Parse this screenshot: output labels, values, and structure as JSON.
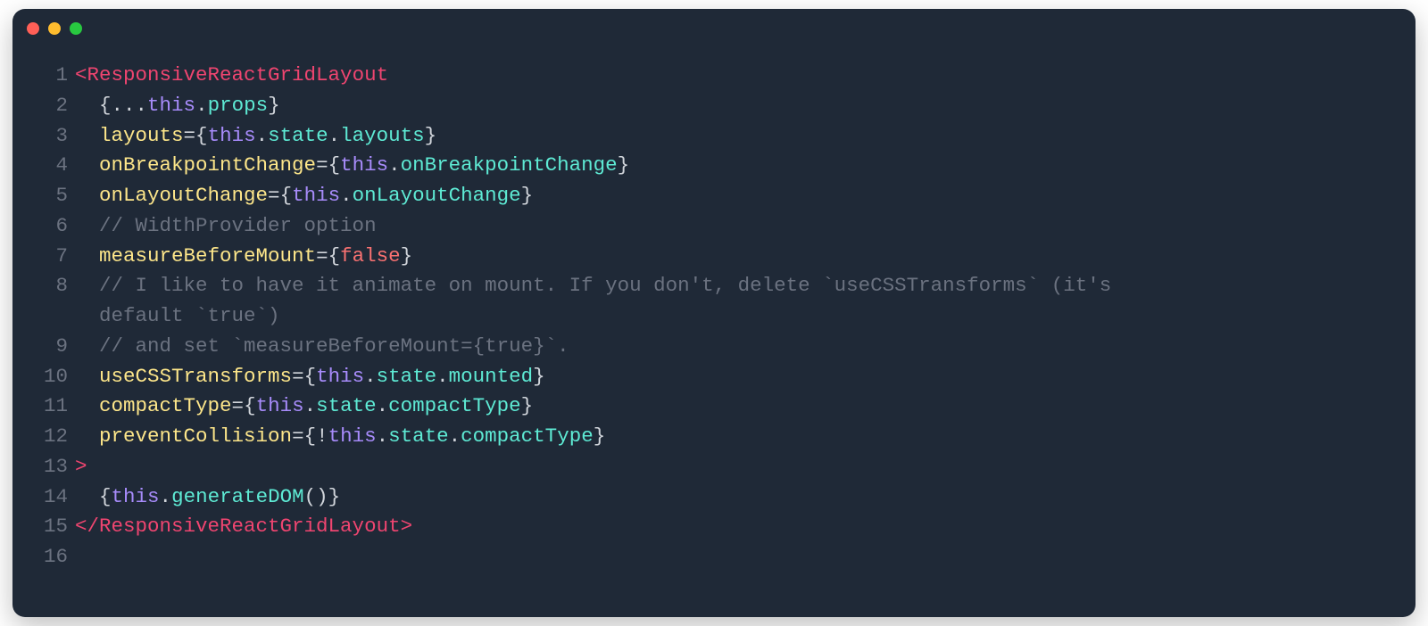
{
  "window": {
    "traffic_colors": {
      "close": "#ff5f57",
      "minimize": "#febc2e",
      "zoom": "#28c840"
    },
    "background": "#1f2937"
  },
  "code": {
    "line_numbers": [
      "1",
      "2",
      "3",
      "4",
      "5",
      "6",
      "7",
      "8",
      "9",
      "10",
      "11",
      "12",
      "13",
      "14",
      "15",
      "16"
    ],
    "lines": [
      {
        "n": "1",
        "segments": [
          {
            "t": "<",
            "c": "t-anglebracket"
          },
          {
            "t": "ResponsiveReactGridLayout",
            "c": "t-tag"
          }
        ]
      },
      {
        "n": "2",
        "segments": [
          {
            "t": "  ",
            "c": ""
          },
          {
            "t": "{",
            "c": "t-brace"
          },
          {
            "t": "...",
            "c": "t-spread"
          },
          {
            "t": "this",
            "c": "t-this"
          },
          {
            "t": ".",
            "c": "t-dot"
          },
          {
            "t": "props",
            "c": "t-prop"
          },
          {
            "t": "}",
            "c": "t-brace"
          }
        ]
      },
      {
        "n": "3",
        "segments": [
          {
            "t": "  ",
            "c": ""
          },
          {
            "t": "layouts",
            "c": "t-attr"
          },
          {
            "t": "=",
            "c": "t-eq"
          },
          {
            "t": "{",
            "c": "t-brace"
          },
          {
            "t": "this",
            "c": "t-this"
          },
          {
            "t": ".",
            "c": "t-dot"
          },
          {
            "t": "state",
            "c": "t-prop"
          },
          {
            "t": ".",
            "c": "t-dot"
          },
          {
            "t": "layouts",
            "c": "t-prop"
          },
          {
            "t": "}",
            "c": "t-brace"
          }
        ]
      },
      {
        "n": "4",
        "segments": [
          {
            "t": "  ",
            "c": ""
          },
          {
            "t": "onBreakpointChange",
            "c": "t-attr"
          },
          {
            "t": "=",
            "c": "t-eq"
          },
          {
            "t": "{",
            "c": "t-brace"
          },
          {
            "t": "this",
            "c": "t-this"
          },
          {
            "t": ".",
            "c": "t-dot"
          },
          {
            "t": "onBreakpointChange",
            "c": "t-prop"
          },
          {
            "t": "}",
            "c": "t-brace"
          }
        ]
      },
      {
        "n": "5",
        "segments": [
          {
            "t": "  ",
            "c": ""
          },
          {
            "t": "onLayoutChange",
            "c": "t-attr"
          },
          {
            "t": "=",
            "c": "t-eq"
          },
          {
            "t": "{",
            "c": "t-brace"
          },
          {
            "t": "this",
            "c": "t-this"
          },
          {
            "t": ".",
            "c": "t-dot"
          },
          {
            "t": "onLayoutChange",
            "c": "t-prop"
          },
          {
            "t": "}",
            "c": "t-brace"
          }
        ]
      },
      {
        "n": "6",
        "segments": [
          {
            "t": "  ",
            "c": ""
          },
          {
            "t": "// WidthProvider option",
            "c": "t-comment"
          }
        ]
      },
      {
        "n": "7",
        "segments": [
          {
            "t": "  ",
            "c": ""
          },
          {
            "t": "measureBeforeMount",
            "c": "t-attr"
          },
          {
            "t": "=",
            "c": "t-eq"
          },
          {
            "t": "{",
            "c": "t-brace"
          },
          {
            "t": "false",
            "c": "t-bool"
          },
          {
            "t": "}",
            "c": "t-brace"
          }
        ]
      },
      {
        "n": "8",
        "segments": [
          {
            "t": "  ",
            "c": ""
          },
          {
            "t": "// I like to have it animate on mount. If you don't, delete `useCSSTransforms` (it's",
            "c": "t-comment"
          }
        ]
      },
      {
        "n": "8b",
        "wrapped": true,
        "segments": [
          {
            "t": "  default `true`)",
            "c": "t-comment"
          }
        ]
      },
      {
        "n": "9",
        "segments": [
          {
            "t": "  ",
            "c": ""
          },
          {
            "t": "// and set `measureBeforeMount={true}`.",
            "c": "t-comment"
          }
        ]
      },
      {
        "n": "10",
        "segments": [
          {
            "t": "  ",
            "c": ""
          },
          {
            "t": "useCSSTransforms",
            "c": "t-attr"
          },
          {
            "t": "=",
            "c": "t-eq"
          },
          {
            "t": "{",
            "c": "t-brace"
          },
          {
            "t": "this",
            "c": "t-this"
          },
          {
            "t": ".",
            "c": "t-dot"
          },
          {
            "t": "state",
            "c": "t-prop"
          },
          {
            "t": ".",
            "c": "t-dot"
          },
          {
            "t": "mounted",
            "c": "t-prop"
          },
          {
            "t": "}",
            "c": "t-brace"
          }
        ]
      },
      {
        "n": "11",
        "segments": [
          {
            "t": "  ",
            "c": ""
          },
          {
            "t": "compactType",
            "c": "t-attr"
          },
          {
            "t": "=",
            "c": "t-eq"
          },
          {
            "t": "{",
            "c": "t-brace"
          },
          {
            "t": "this",
            "c": "t-this"
          },
          {
            "t": ".",
            "c": "t-dot"
          },
          {
            "t": "state",
            "c": "t-prop"
          },
          {
            "t": ".",
            "c": "t-dot"
          },
          {
            "t": "compactType",
            "c": "t-prop"
          },
          {
            "t": "}",
            "c": "t-brace"
          }
        ]
      },
      {
        "n": "12",
        "segments": [
          {
            "t": "  ",
            "c": ""
          },
          {
            "t": "preventCollision",
            "c": "t-attr"
          },
          {
            "t": "=",
            "c": "t-eq"
          },
          {
            "t": "{",
            "c": "t-brace"
          },
          {
            "t": "!",
            "c": "t-op"
          },
          {
            "t": "this",
            "c": "t-this"
          },
          {
            "t": ".",
            "c": "t-dot"
          },
          {
            "t": "state",
            "c": "t-prop"
          },
          {
            "t": ".",
            "c": "t-dot"
          },
          {
            "t": "compactType",
            "c": "t-prop"
          },
          {
            "t": "}",
            "c": "t-brace"
          }
        ]
      },
      {
        "n": "13",
        "segments": [
          {
            "t": ">",
            "c": "t-anglebracket"
          }
        ]
      },
      {
        "n": "14",
        "segments": [
          {
            "t": "  ",
            "c": ""
          },
          {
            "t": "{",
            "c": "t-brace"
          },
          {
            "t": "this",
            "c": "t-this"
          },
          {
            "t": ".",
            "c": "t-dot"
          },
          {
            "t": "generateDOM",
            "c": "t-prop"
          },
          {
            "t": "(",
            "c": "t-brace"
          },
          {
            "t": ")",
            "c": "t-brace"
          },
          {
            "t": "}",
            "c": "t-brace"
          }
        ]
      },
      {
        "n": "15",
        "segments": [
          {
            "t": "</",
            "c": "t-anglebracket"
          },
          {
            "t": "ResponsiveReactGridLayout",
            "c": "t-tag"
          },
          {
            "t": ">",
            "c": "t-anglebracket"
          }
        ]
      },
      {
        "n": "16",
        "segments": [
          {
            "t": "",
            "c": ""
          }
        ]
      }
    ]
  }
}
